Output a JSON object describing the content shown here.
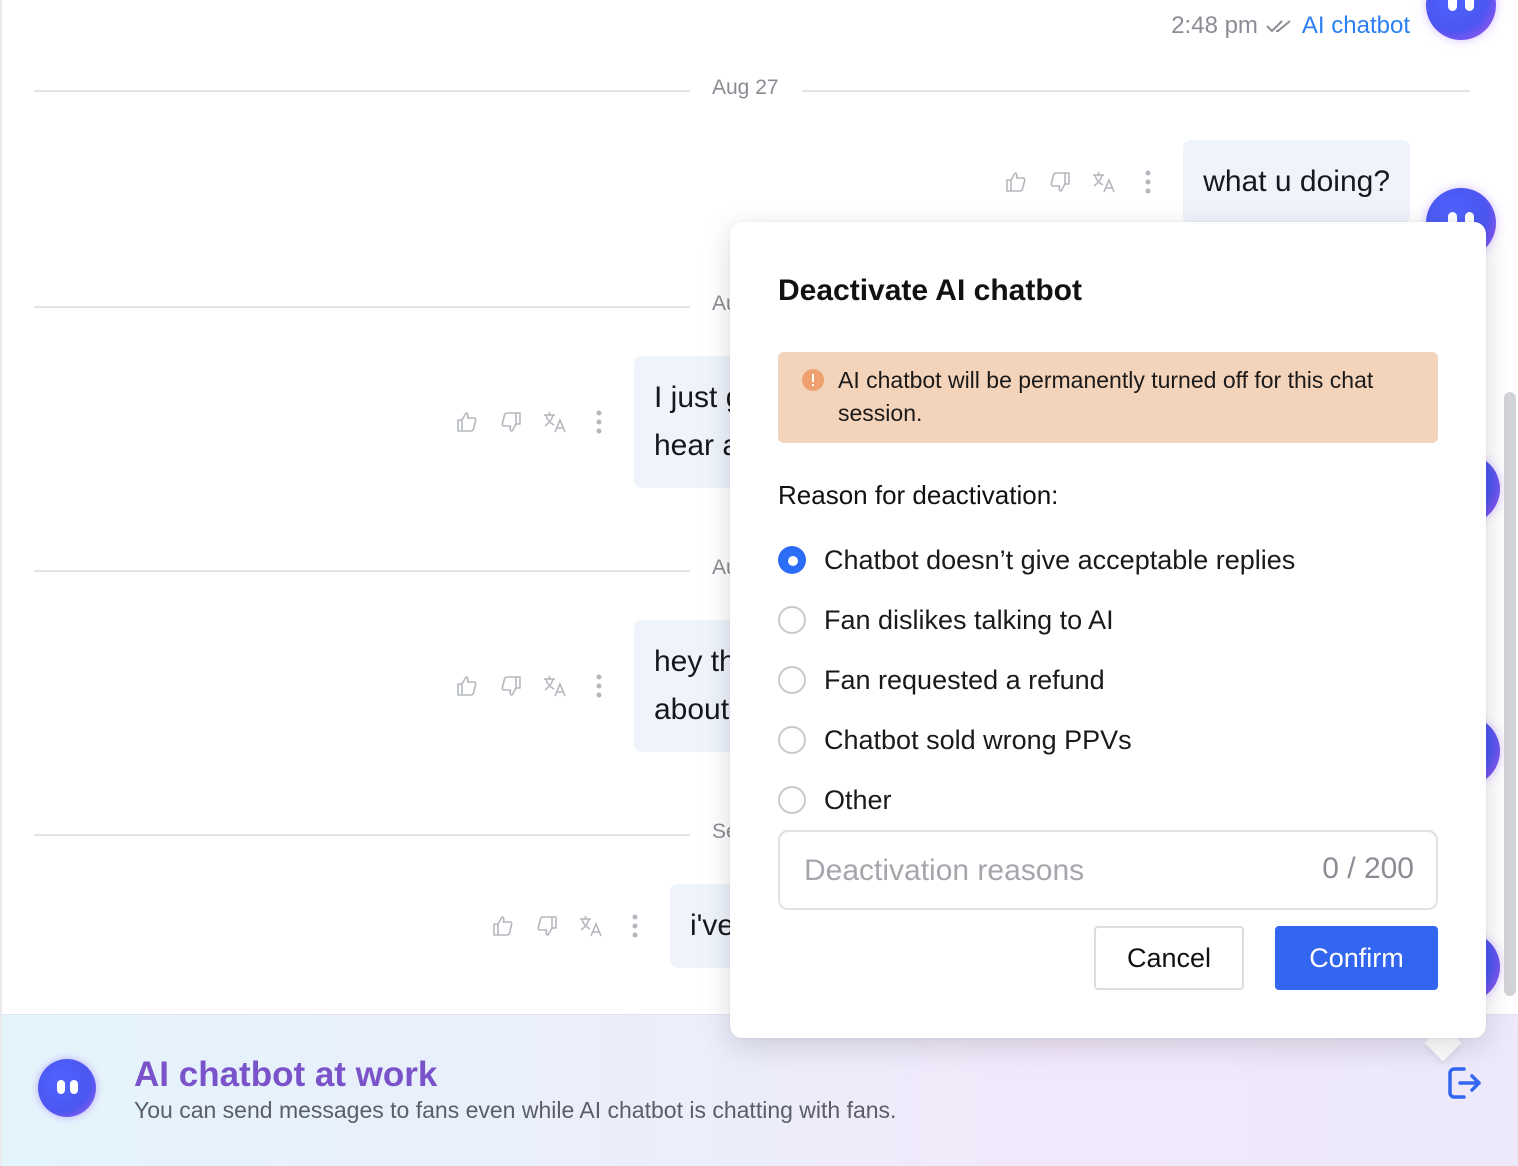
{
  "chat": {
    "top_message": {
      "time": "2:48 pm",
      "sender": "AI chatbot",
      "status_icon": "double-check-icon"
    },
    "dividers": [
      "Aug 27",
      "Au",
      "Au",
      "Se"
    ],
    "messages": [
      {
        "text": "what u doing?"
      },
      {
        "text": "I just g\nhear a"
      },
      {
        "text": "hey th\nabout"
      },
      {
        "text": "i've"
      }
    ],
    "action_icons": [
      "thumbs-up-icon",
      "thumbs-down-icon",
      "translate-icon",
      "more-icon"
    ]
  },
  "modal": {
    "title": "Deactivate AI chatbot",
    "warning": "AI chatbot will be permanently turned off for this chat session.",
    "reason_label": "Reason for deactivation:",
    "options": [
      {
        "label": "Chatbot doesn’t give acceptable replies",
        "selected": true
      },
      {
        "label": "Fan dislikes talking to AI",
        "selected": false
      },
      {
        "label": "Fan requested a refund",
        "selected": false
      },
      {
        "label": "Chatbot sold wrong PPVs",
        "selected": false
      },
      {
        "label": "Other",
        "selected": false
      }
    ],
    "input": {
      "placeholder": "Deactivation reasons",
      "value": "",
      "counter": "0 / 200"
    },
    "cancel_label": "Cancel",
    "confirm_label": "Confirm"
  },
  "bottom_bar": {
    "title": "AI chatbot at work",
    "subtitle": "You can send messages to fans even while AI chatbot is chatting with fans."
  },
  "colors": {
    "accent": "#3366f0",
    "link": "#2b7ff5",
    "warning_bg": "#f4d3bb",
    "bubble_bg": "#eef3fc",
    "bot_title": "#7a52c9"
  }
}
